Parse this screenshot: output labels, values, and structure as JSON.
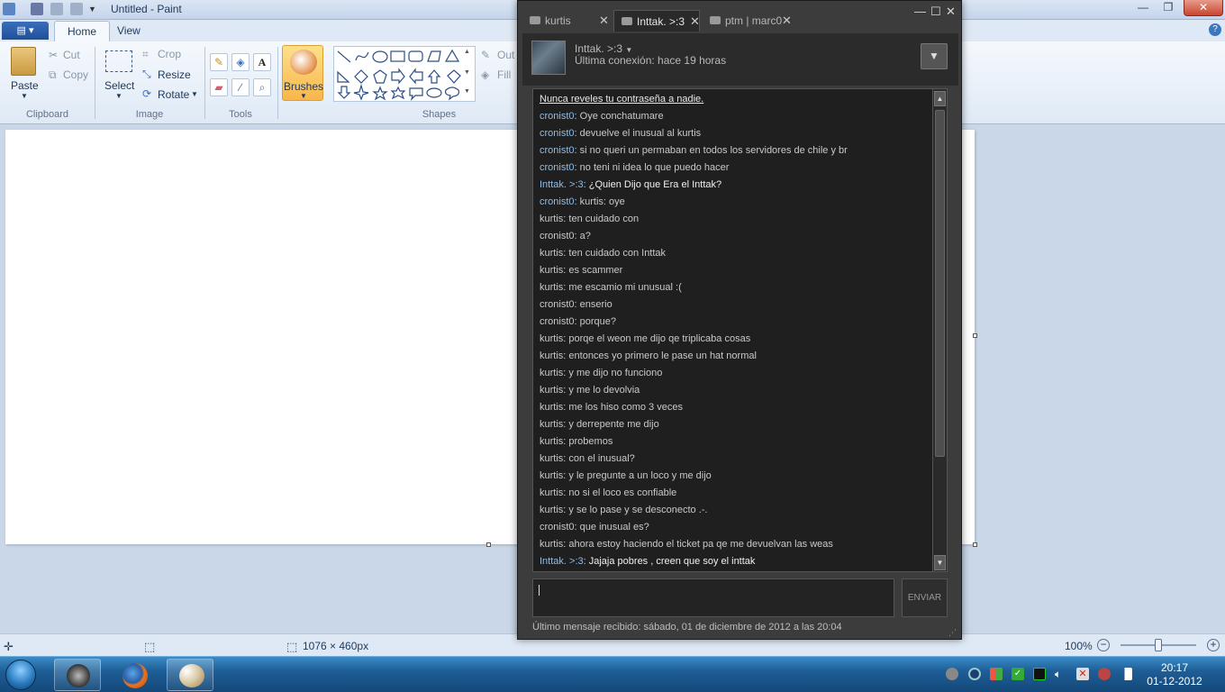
{
  "paint": {
    "title": "Untitled - Paint",
    "tabs": [
      "Home",
      "View"
    ],
    "clipboard": {
      "paste": "Paste",
      "cut": "Cut",
      "copy": "Copy",
      "group": "Clipboard"
    },
    "image": {
      "select": "Select",
      "crop": "Crop",
      "resize": "Resize",
      "rotate": "Rotate",
      "group": "Image"
    },
    "tools": {
      "group": "Tools"
    },
    "brushes": "Brushes",
    "shapes": {
      "group": "Shapes",
      "outline": "Out",
      "fill": "Fill"
    },
    "status": {
      "canvas_size": "1076 × 460px",
      "zoom": "100%"
    }
  },
  "taskbar": {
    "time": "20:17",
    "date": "01-12-2012"
  },
  "chat": {
    "tabs": [
      {
        "label": "kurtis"
      },
      {
        "label": "Inttak. >:3"
      },
      {
        "label": "ptm | marc0"
      }
    ],
    "friend_name": "Inttak. >:3",
    "last_seen": "Última conexión: hace 19 horas",
    "warning": "Nunca reveles tu contraseña a nadie.",
    "messages": [
      {
        "name": "cronist0",
        "text": "Oye conchatumare",
        "style": "blue"
      },
      {
        "name": "cronist0",
        "text": "devuelve el inusual al kurtis",
        "style": "blue"
      },
      {
        "name": "cronist0",
        "text": "si no queri un permaban en todos los servidores de chile y br",
        "style": "blue"
      },
      {
        "name": "cronist0",
        "text": "no teni ni idea lo que puedo hacer",
        "style": "blue"
      },
      {
        "name": "Inttak. >:3",
        "text": "¿Quien Dijo que Era el Inttak?",
        "style": "self"
      },
      {
        "name": "cronist0",
        "text": "kurtis: oye",
        "style": "blue"
      },
      {
        "name": "kurtis",
        "text": "ten cuidado con",
        "style": "gray"
      },
      {
        "name": "cronist0",
        "text": "a?",
        "style": "gray"
      },
      {
        "name": "kurtis",
        "text": "ten cuidado con Inttak",
        "style": "gray"
      },
      {
        "name": "kurtis",
        "text": "es scammer",
        "style": "gray"
      },
      {
        "name": "kurtis",
        "text": "me escamio mi unusual :(",
        "style": "gray"
      },
      {
        "name": "cronist0",
        "text": "enserio",
        "style": "gray"
      },
      {
        "name": "cronist0",
        "text": "porque?",
        "style": "gray"
      },
      {
        "name": "kurtis",
        "text": "porqe el weon me dijo qe triplicaba cosas",
        "style": "gray"
      },
      {
        "name": "kurtis",
        "text": "entonces yo primero le pase un hat normal",
        "style": "gray"
      },
      {
        "name": "kurtis",
        "text": "y me dijo no funciono",
        "style": "gray"
      },
      {
        "name": "kurtis",
        "text": "y me lo devolvia",
        "style": "gray"
      },
      {
        "name": "kurtis",
        "text": "me los hiso como 3 veces",
        "style": "gray"
      },
      {
        "name": "kurtis",
        "text": "y derrepente me dijo",
        "style": "gray"
      },
      {
        "name": "kurtis",
        "text": "probemos",
        "style": "gray"
      },
      {
        "name": "kurtis",
        "text": "con el inusual?",
        "style": "gray"
      },
      {
        "name": "kurtis",
        "text": "y le pregunte a un loco y me dijo",
        "style": "gray"
      },
      {
        "name": "kurtis",
        "text": "no si el loco es confiable",
        "style": "gray"
      },
      {
        "name": "kurtis",
        "text": "y se lo pase y se desconecto .-.",
        "style": "gray"
      },
      {
        "name": "cronist0",
        "text": "que inusual es?",
        "style": "gray"
      },
      {
        "name": "kurtis",
        "text": "ahora estoy haciendo el ticket pa qe me devuelvan las weas",
        "style": "gray"
      },
      {
        "name": "Inttak. >:3",
        "text": "Jajaja pobres , creen que soy el inttak",
        "style": "self"
      }
    ],
    "send_label": "ENVIAR",
    "last_received": "Último mensaje recibido: sábado, 01 de diciembre de 2012 a las 20:04"
  }
}
